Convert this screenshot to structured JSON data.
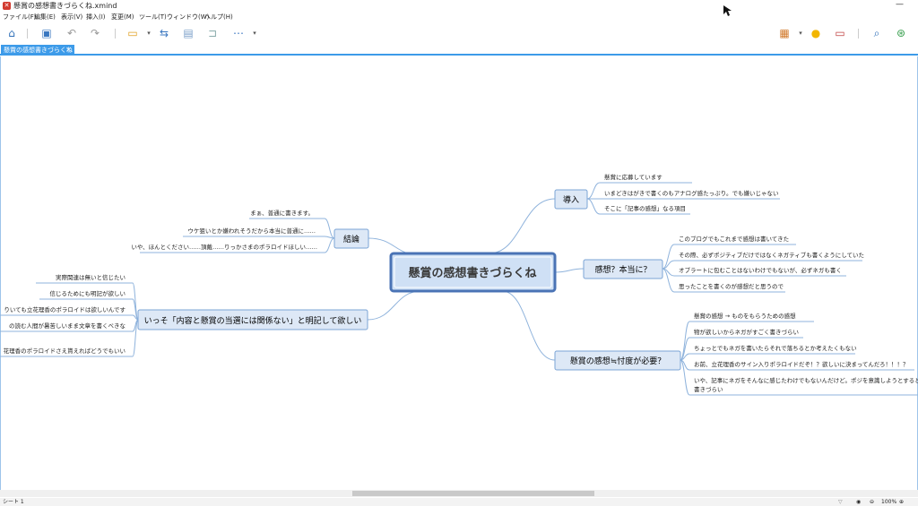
{
  "window": {
    "title": "懸賞の感想書きづらくね.xmind",
    "minimize": "—"
  },
  "menu": [
    "ファイル(F)",
    "編集(E)",
    "表示(V)",
    "挿入(I)",
    "変更(M)",
    "ツール(T)",
    "ウィンドウ(W)",
    "ヘルプ(H)"
  ],
  "toolbar": {
    "icons": [
      "home-icon",
      "save-icon",
      "undo-icon",
      "redo-icon",
      "topic-icon",
      "relationship-icon",
      "boundary-icon",
      "summary-icon",
      "more-icon",
      "presentation-icon",
      "idea-icon",
      "outline-icon",
      "search-icon",
      "share-icon"
    ]
  },
  "tab": {
    "label": "懸賞の感想書きづらくね",
    "close": "✕"
  },
  "status": {
    "sheet": "シート 1",
    "zoom": "100%"
  },
  "colors": {
    "accent": "#3d9be9",
    "central_fill": "#cfe0f5",
    "central_border": "#4a73b5",
    "topic_fill": "#dde8f6",
    "topic_border": "#7ba4d6",
    "line": "#8fb3dc"
  },
  "mindmap": {
    "central": "懸賞の感想書きづらくね",
    "topics": [
      {
        "id": "intro",
        "label": "導入",
        "children": [
          "懸賞に応募しています",
          "いまどきはがきで書くのもアナログ感たっぷり。でも嫌いじゃない",
          "そこに「記事の感想」なる項目"
        ]
      },
      {
        "id": "honest",
        "label": "感想？本当に？",
        "children": [
          "このブログでもこれまで感想は書いてきた",
          "その際、必ずポジティブだけではなくネガティブも書くようにしていた",
          "オブラートに包むことはないわけでもないが、必ずネガも書く",
          "思ったことを書くのが感想だと思うので"
        ]
      },
      {
        "id": "sontaku",
        "label": "懸賞の感想≒忖度が必要？",
        "children": [
          "懸賞の感想 → ものをもらうための感想",
          "物が欲しいからネガがすごく書きづらい",
          "ちょっとでもネガを書いたらそれで落ちるとか考えたくもない",
          "お前、立花理香のサイン入りポラロイドだぞ！？欲しいに決まってんだろ！！！？",
          "いや、記事にネガをそんなに感じたわけでもないんだけど。ポジを意識しようとすると",
          "書きづらい"
        ]
      },
      {
        "id": "conclusion",
        "label": "結論",
        "children": [
          "まぁ、普通に書きます。",
          "ウケ狙いとか嫌われそうだから本当に普通に……",
          "いや、ほんとください……頂戴……りっかさまのポラロイドほしい……"
        ]
      },
      {
        "id": "explicit",
        "label": "いっそ「内容と懸賞の当選には関係ない」と明記して欲しい",
        "children": [
          "実際関連は無いと信じたい",
          "信じるためにも明記が欲しい",
          "りいても立花理香のポラロイドは欲しいんです",
          "の読む人間が暑苦しいまま文章を書くべきな",
          "花理香のポラロイドさえ貰えればどうでもいい"
        ]
      }
    ]
  }
}
